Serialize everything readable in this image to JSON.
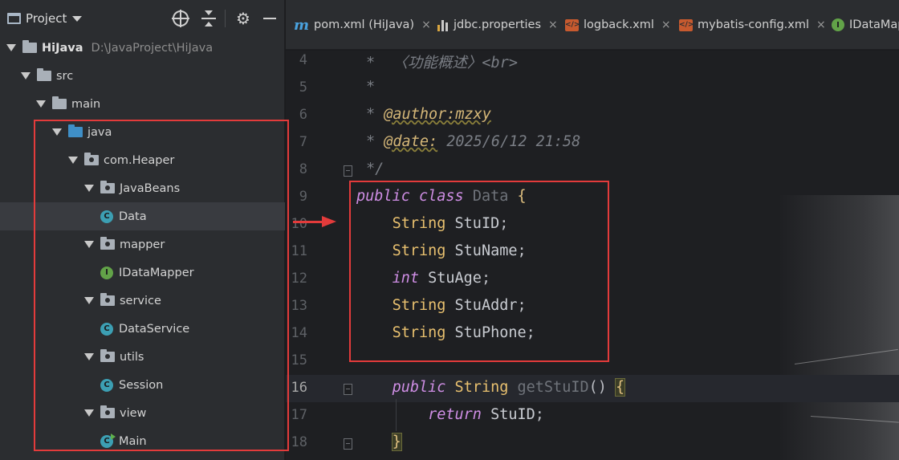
{
  "project_panel": {
    "title": "Project",
    "tree": [
      {
        "label": "HiJava",
        "path": "D:\\JavaProject\\HiJava",
        "kind": "root",
        "expanded": true
      },
      {
        "label": "src",
        "kind": "folder",
        "expanded": true
      },
      {
        "label": "main",
        "kind": "folder",
        "expanded": true
      },
      {
        "label": "java",
        "kind": "source-folder",
        "expanded": true
      },
      {
        "label": "com.Heaper",
        "kind": "package",
        "expanded": true
      },
      {
        "label": "JavaBeans",
        "kind": "package",
        "expanded": true
      },
      {
        "label": "Data",
        "kind": "class",
        "selected": true
      },
      {
        "label": "mapper",
        "kind": "package",
        "expanded": true
      },
      {
        "label": "IDataMapper",
        "kind": "interface"
      },
      {
        "label": "service",
        "kind": "package",
        "expanded": true
      },
      {
        "label": "DataService",
        "kind": "class"
      },
      {
        "label": "utils",
        "kind": "package",
        "expanded": true
      },
      {
        "label": "Session",
        "kind": "class"
      },
      {
        "label": "view",
        "kind": "package",
        "expanded": true
      },
      {
        "label": "Main",
        "kind": "main-class"
      }
    ]
  },
  "tabs": [
    {
      "label": "pom.xml (HiJava)",
      "icon": "maven-icon"
    },
    {
      "label": "jdbc.properties",
      "icon": "properties-icon"
    },
    {
      "label": "logback.xml",
      "icon": "xml-icon"
    },
    {
      "label": "mybatis-config.xml",
      "icon": "xml-icon"
    },
    {
      "label": "IDataMap",
      "icon": "interface-icon"
    }
  ],
  "icon_letters": {
    "class": "C",
    "interface": "I",
    "xml": "</>"
  },
  "tab_close_glyph": "×",
  "editor": {
    "current_line": 16,
    "lines": [
      {
        "n": "4",
        "tokens": [
          [
            "comment",
            "*  〈功能概述〉<br>"
          ]
        ]
      },
      {
        "n": "5",
        "tokens": [
          [
            "comment",
            "*"
          ]
        ]
      },
      {
        "n": "6",
        "tokens": [
          [
            "comment",
            "* "
          ],
          [
            "tag",
            "@author:mzxy"
          ]
        ]
      },
      {
        "n": "7",
        "tokens": [
          [
            "comment",
            "* "
          ],
          [
            "tag",
            "@date:"
          ],
          [
            "comment",
            " 2025/6/12 21:58"
          ]
        ]
      },
      {
        "n": "8",
        "tokens": [
          [
            "comment",
            "*/"
          ]
        ]
      },
      {
        "n": "9",
        "tokens": [
          [
            "kw",
            "public"
          ],
          [
            "punc",
            " "
          ],
          [
            "kw",
            "class"
          ],
          [
            "punc",
            " "
          ],
          [
            "unused",
            "Data"
          ],
          [
            "punc",
            " "
          ],
          [
            "brace",
            "{"
          ]
        ]
      },
      {
        "n": "10",
        "tokens": [
          [
            "punc",
            "    "
          ],
          [
            "type",
            "String"
          ],
          [
            "ident",
            " StuID"
          ],
          [
            "punc",
            ";"
          ]
        ]
      },
      {
        "n": "11",
        "tokens": [
          [
            "punc",
            "    "
          ],
          [
            "type",
            "String"
          ],
          [
            "ident",
            " StuName"
          ],
          [
            "punc",
            ";"
          ]
        ]
      },
      {
        "n": "12",
        "tokens": [
          [
            "punc",
            "    "
          ],
          [
            "kw",
            "int"
          ],
          [
            "ident",
            " StuAge"
          ],
          [
            "punc",
            ";"
          ]
        ]
      },
      {
        "n": "13",
        "tokens": [
          [
            "punc",
            "    "
          ],
          [
            "type",
            "String"
          ],
          [
            "ident",
            " StuAddr"
          ],
          [
            "punc",
            ";"
          ]
        ]
      },
      {
        "n": "14",
        "tokens": [
          [
            "punc",
            "    "
          ],
          [
            "type",
            "String"
          ],
          [
            "ident",
            " StuPhone"
          ],
          [
            "punc",
            ";"
          ]
        ]
      },
      {
        "n": "15",
        "tokens": []
      },
      {
        "n": "16",
        "tokens": [
          [
            "punc",
            "    "
          ],
          [
            "kw",
            "public"
          ],
          [
            "punc",
            " "
          ],
          [
            "type",
            "String"
          ],
          [
            "punc",
            " "
          ],
          [
            "unused",
            "getStuID"
          ],
          [
            "punc",
            "() "
          ],
          [
            "brace-hl",
            "{"
          ]
        ]
      },
      {
        "n": "17",
        "tokens": [
          [
            "punc",
            "        "
          ],
          [
            "kw",
            "return"
          ],
          [
            "ident",
            " StuID"
          ],
          [
            "punc",
            ";"
          ]
        ]
      },
      {
        "n": "18",
        "tokens": [
          [
            "punc",
            "    "
          ],
          [
            "brace-hl",
            "}"
          ]
        ]
      }
    ]
  },
  "colors": {
    "annotation": "#e33b3b",
    "keyword": "#cf8ee5",
    "type": "#e8c06f",
    "comment": "#7a7e85",
    "background": "#1e1f22"
  }
}
